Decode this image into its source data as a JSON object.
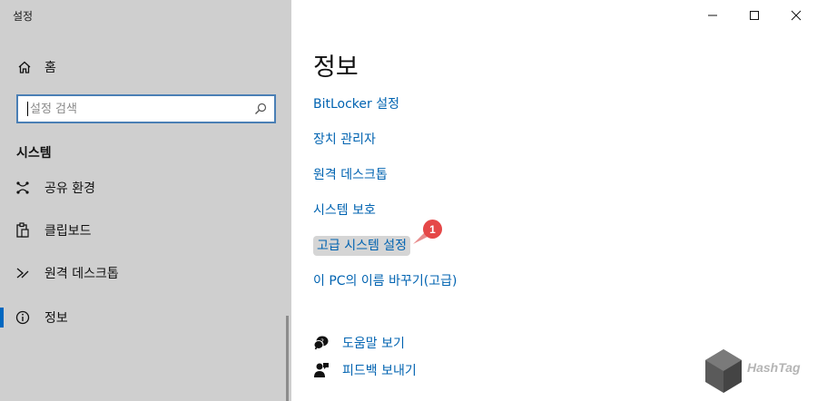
{
  "window": {
    "title": "설정"
  },
  "sidebar": {
    "home_label": "홈",
    "search_placeholder": "설정 검색",
    "section_title": "시스템",
    "items": [
      {
        "label": "공유 환경",
        "icon": "shared-experiences-icon"
      },
      {
        "label": "클립보드",
        "icon": "clipboard-icon"
      },
      {
        "label": "원격 데스크톱",
        "icon": "remote-desktop-icon"
      },
      {
        "label": "정보",
        "icon": "info-icon",
        "active": true
      }
    ]
  },
  "main": {
    "title": "정보",
    "links": [
      "BitLocker 설정",
      "장치 관리자",
      "원격 데스크톱",
      "시스템 보호",
      "고급 시스템 설정",
      "이 PC의 이름 바꾸기(고급)"
    ],
    "highlighted_link_index": 4,
    "badge": "1",
    "help_links": [
      {
        "label": "도움말 보기",
        "icon": "help-icon"
      },
      {
        "label": "피드백 보내기",
        "icon": "feedback-icon"
      }
    ]
  },
  "watermark": {
    "text": "HashTag"
  },
  "colors": {
    "accent": "#0063b1",
    "sidebar_bg": "#cfcfcf",
    "badge": "#e54848"
  }
}
